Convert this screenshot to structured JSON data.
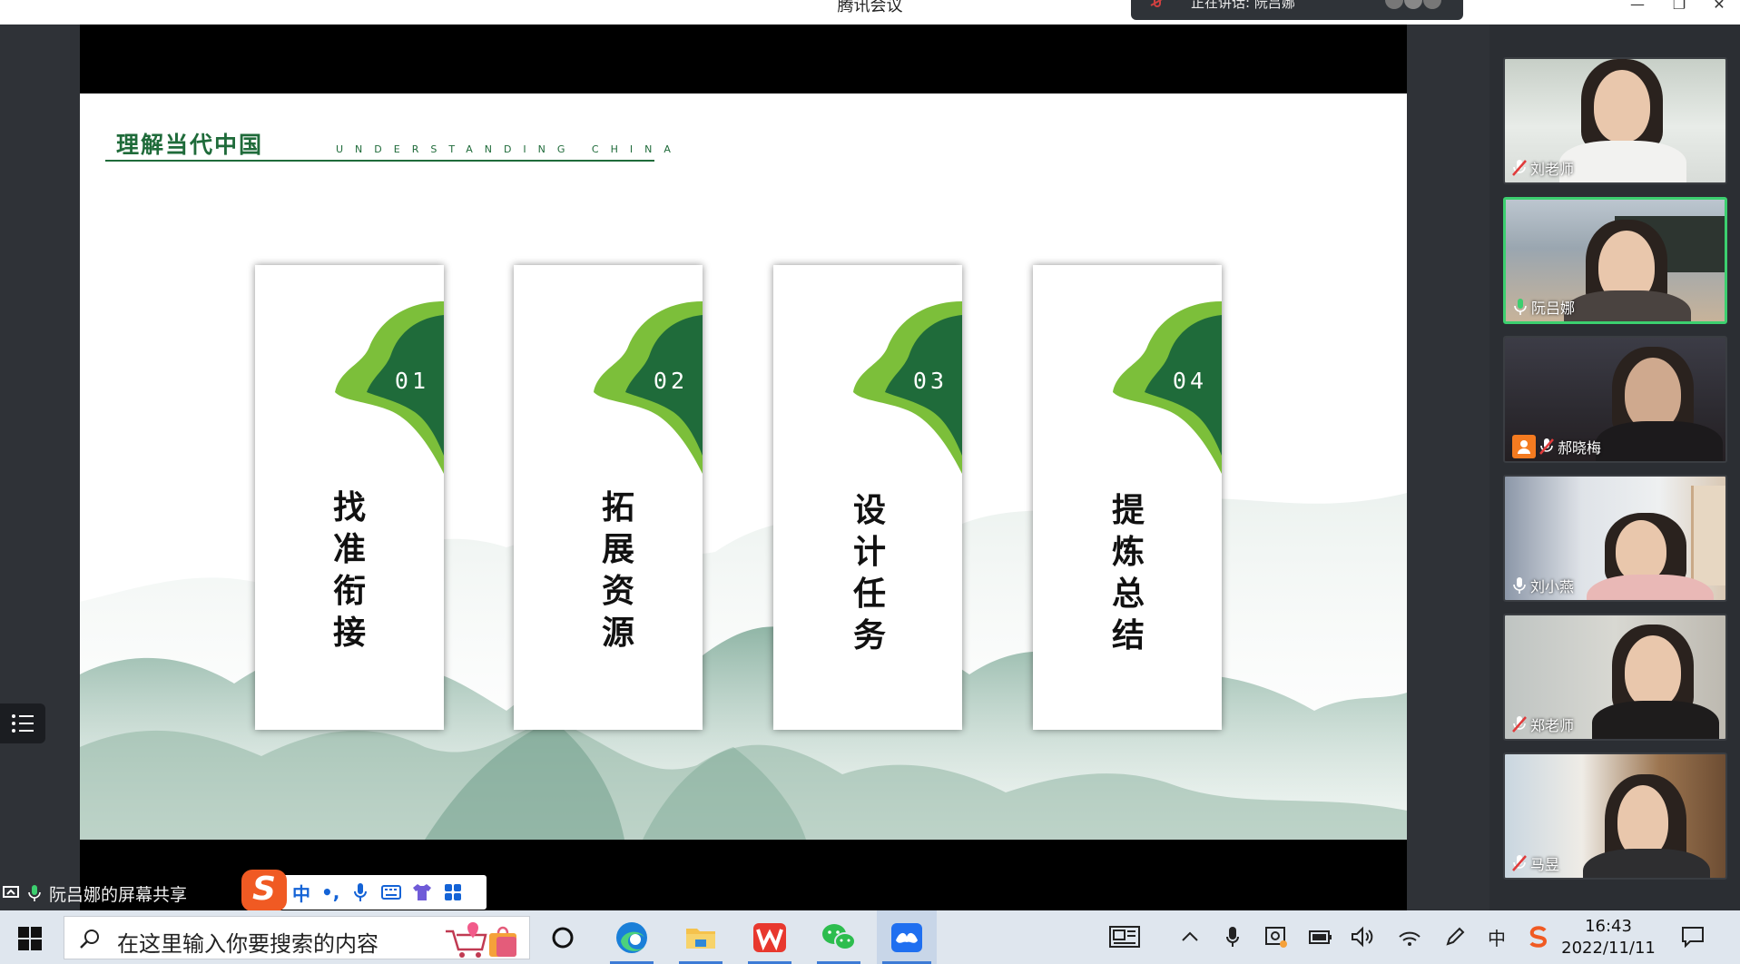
{
  "window": {
    "title": "腾讯会议",
    "speaking_text": "正在讲话: 阮吕娜",
    "minimize": "—",
    "restore": "❐",
    "close": "✕"
  },
  "slide": {
    "title": "理解当代中国",
    "subtitle": "UNDERSTANDING CHINA",
    "cards": [
      {
        "number": "01",
        "label": "找准衔接"
      },
      {
        "number": "02",
        "label": "拓展资源"
      },
      {
        "number": "03",
        "label": "设计任务"
      },
      {
        "number": "04",
        "label": "提炼总结"
      }
    ],
    "accent_dark": "#1f6b3a",
    "accent_light": "#7cbf3a"
  },
  "participants": [
    {
      "name": "刘老师",
      "mic": "muted",
      "active": false,
      "host": false
    },
    {
      "name": "阮吕娜",
      "mic": "speaking",
      "active": true,
      "host": false
    },
    {
      "name": "郝晓梅",
      "mic": "muted",
      "active": false,
      "host": true
    },
    {
      "name": "刘小燕",
      "mic": "on",
      "active": false,
      "host": false
    },
    {
      "name": "郑老师",
      "mic": "muted",
      "active": false,
      "host": false
    },
    {
      "name": "马昱",
      "mic": "muted",
      "active": false,
      "host": false
    }
  ],
  "share_status": "阮吕娜的屏幕共享",
  "ime": {
    "logo": "S",
    "mode": "中",
    "punct": "•,"
  },
  "taskbar": {
    "search_placeholder": "在这里输入你要搜索的内容",
    "apps": [
      "cortana-icon",
      "edge-icon",
      "file-explorer-icon",
      "wps-icon",
      "wechat-icon",
      "tencent-meeting-icon"
    ],
    "time": "16:43",
    "date": "2022/11/11",
    "input_lang": "中"
  }
}
